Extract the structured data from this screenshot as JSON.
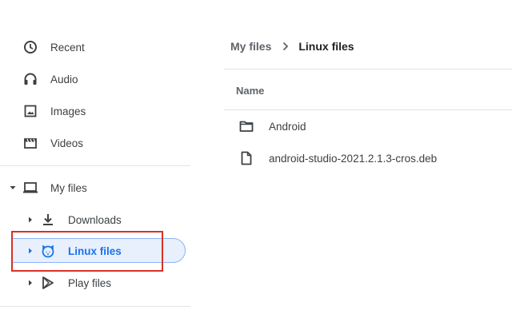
{
  "sidebar": {
    "recent": "Recent",
    "audio": "Audio",
    "images": "Images",
    "videos": "Videos",
    "my_files": "My files",
    "downloads": "Downloads",
    "linux_files": "Linux files",
    "play_files": "Play files"
  },
  "breadcrumb": {
    "parent": "My files",
    "current": "Linux files"
  },
  "columns": {
    "name": "Name"
  },
  "files": [
    {
      "name": "Android",
      "icon": "folder-icon"
    },
    {
      "name": "android-studio-2021.2.1.3-cros.deb",
      "icon": "file-icon"
    }
  ],
  "colors": {
    "selected_text": "#1a73e8",
    "selected_bg": "#e8f0fe",
    "highlight_border": "#d93025",
    "icon": "#3c4043"
  }
}
